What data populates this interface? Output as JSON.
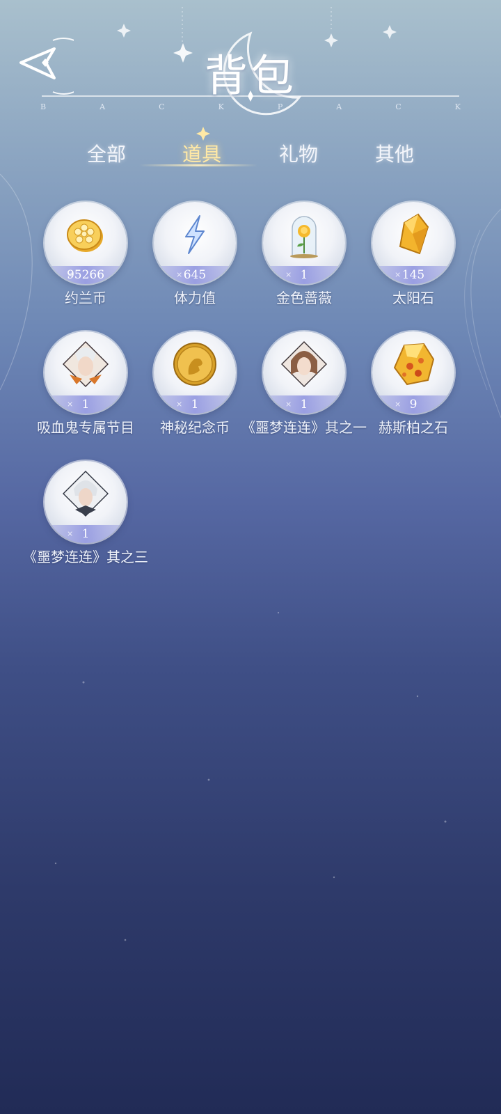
{
  "header": {
    "title": "背包",
    "subtitle_letters": [
      "B",
      "A",
      "C",
      "K",
      "P",
      "A",
      "C",
      "K"
    ]
  },
  "tabs": [
    {
      "label": "全部",
      "active": false
    },
    {
      "label": "道具",
      "active": true
    },
    {
      "label": "礼物",
      "active": false
    },
    {
      "label": "其他",
      "active": false
    }
  ],
  "items": [
    {
      "name": "约兰币",
      "count": "95266",
      "icon": "gold-coin-icon"
    },
    {
      "name": "体力值",
      "count": "645",
      "icon": "lightning-icon"
    },
    {
      "name": "金色蔷薇",
      "count": "1",
      "icon": "golden-rose-icon"
    },
    {
      "name": "太阳石",
      "count": "145",
      "icon": "sun-stone-icon"
    },
    {
      "name": "吸血鬼专属节目",
      "count": "1",
      "icon": "vampire-portrait-icon"
    },
    {
      "name": "神秘纪念币",
      "count": "1",
      "icon": "commemorative-coin-icon"
    },
    {
      "name": "《噩梦连连》其之一",
      "count": "1",
      "icon": "brown-hair-portrait-icon"
    },
    {
      "name": "赫斯柏之石",
      "count": "9",
      "icon": "amber-stone-icon"
    },
    {
      "name": "《噩梦连连》其之三",
      "count": "1",
      "icon": "white-hair-portrait-icon"
    }
  ],
  "colors": {
    "active_tab": "#ffe9a6",
    "count_bar": "#969be1",
    "bg_top": "#a9c0cd",
    "bg_bottom": "#212b56"
  }
}
